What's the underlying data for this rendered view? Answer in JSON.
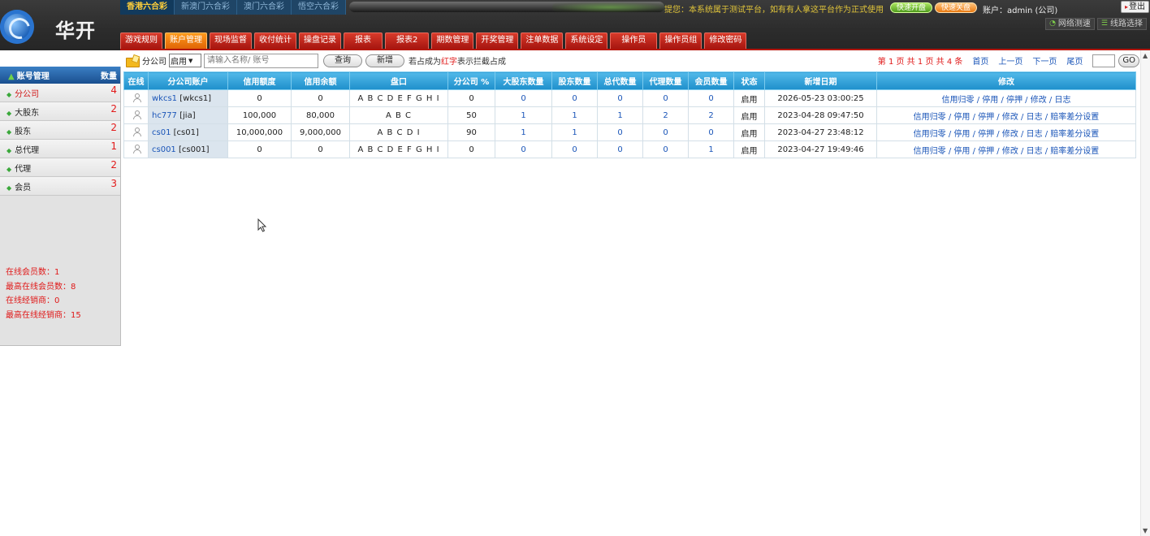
{
  "header": {
    "logo_text": "华开",
    "lottery_tabs": [
      "香港六合彩",
      "新澳门六合彩",
      "澳门六合彩",
      "悟空六合彩"
    ],
    "notice": "提您：本系统属于测试平台，如有有人拿这平台作为正式使用",
    "quick_open": "快速开盘",
    "quick_close": "快速关盘",
    "account": "账户：admin (公司)",
    "logout": "登出",
    "net_test": "网络测速",
    "line_select": "线路选择",
    "nav": [
      "游戏规则",
      "账户管理",
      "现场监督",
      "收付统计",
      "操盘记录",
      "报表",
      "报表2",
      "期数管理",
      "开奖管理",
      "注单数据",
      "系统设定",
      "操作员",
      "操作员组",
      "修改密码"
    ],
    "active_nav": "账户管理"
  },
  "sidebar": {
    "title": "账号管理",
    "count_header": "数量",
    "items": [
      {
        "label": "分公司",
        "count": "4"
      },
      {
        "label": "大股东",
        "count": "2"
      },
      {
        "label": "股东",
        "count": "2"
      },
      {
        "label": "总代理",
        "count": "1"
      },
      {
        "label": "代理",
        "count": "2"
      },
      {
        "label": "会员",
        "count": "3"
      }
    ],
    "stats": [
      "在线会员数：1",
      "最高在线会员数：8",
      "在线经销商：0",
      "最高在线经销商：15"
    ]
  },
  "filter": {
    "label": "分公司",
    "status_value": "启用",
    "search_placeholder": "请输入名称/ 账号",
    "query_button": "查询",
    "add_button": "新增",
    "hint_prefix": "若占成为",
    "hint_red": "红字",
    "hint_suffix": "表示拦截占成"
  },
  "pager": {
    "text_1": "第",
    "page": "1",
    "text_2": "页 共",
    "total_pages": "1",
    "text_3": "页 共",
    "total_items": "4",
    "text_4": "条",
    "first": "首页",
    "prev": "上一页",
    "next": "下一页",
    "last": "尾页",
    "go": "GO"
  },
  "table": {
    "columns": [
      "在线",
      "分公司账户",
      "信用额度",
      "信用余额",
      "盘口",
      "分公司 %",
      "大股东数量",
      "股东数量",
      "总代数量",
      "代理数量",
      "会员数量",
      "状态",
      "新增日期",
      "修改"
    ],
    "rows": [
      {
        "account": "wkcs1",
        "name": "[wkcs1]",
        "credit": "0",
        "balance": "0",
        "pan": "A B C D E F G H I",
        "pct": "0",
        "big_holders": "0",
        "holders": "0",
        "general_agents": "0",
        "agents": "0",
        "members": "0",
        "status": "启用",
        "date": "2026-05-23 03:00:25",
        "ops": "信用归零 / 停用 / 停押 / 修改 / 日志"
      },
      {
        "account": "hc777",
        "name": "[jia]",
        "credit": "100,000",
        "balance": "80,000",
        "pan": "A B C",
        "pct": "50",
        "big_holders": "1",
        "holders": "1",
        "general_agents": "1",
        "agents": "2",
        "members": "2",
        "status": "启用",
        "date": "2023-04-28 09:47:50",
        "ops": "信用归零 / 停用 / 停押 / 修改 / 日志 / 赔率差分设置"
      },
      {
        "account": "cs01",
        "name": "[cs01]",
        "credit": "10,000,000",
        "balance": "9,000,000",
        "pan": "A B C D I",
        "pct": "90",
        "big_holders": "1",
        "holders": "1",
        "general_agents": "0",
        "agents": "0",
        "members": "0",
        "status": "启用",
        "date": "2023-04-27 23:48:12",
        "ops": "信用归零 / 停用 / 停押 / 修改 / 日志 / 赔率差分设置"
      },
      {
        "account": "cs001",
        "name": "[cs001]",
        "credit": "0",
        "balance": "0",
        "pan": "A B C D E F G H I",
        "pct": "0",
        "big_holders": "0",
        "holders": "0",
        "general_agents": "0",
        "agents": "0",
        "members": "1",
        "status": "启用",
        "date": "2023-04-27 19:49:46",
        "ops": "信用归零 / 停用 / 停押 / 修改 / 日志 / 赔率差分设置"
      }
    ]
  }
}
